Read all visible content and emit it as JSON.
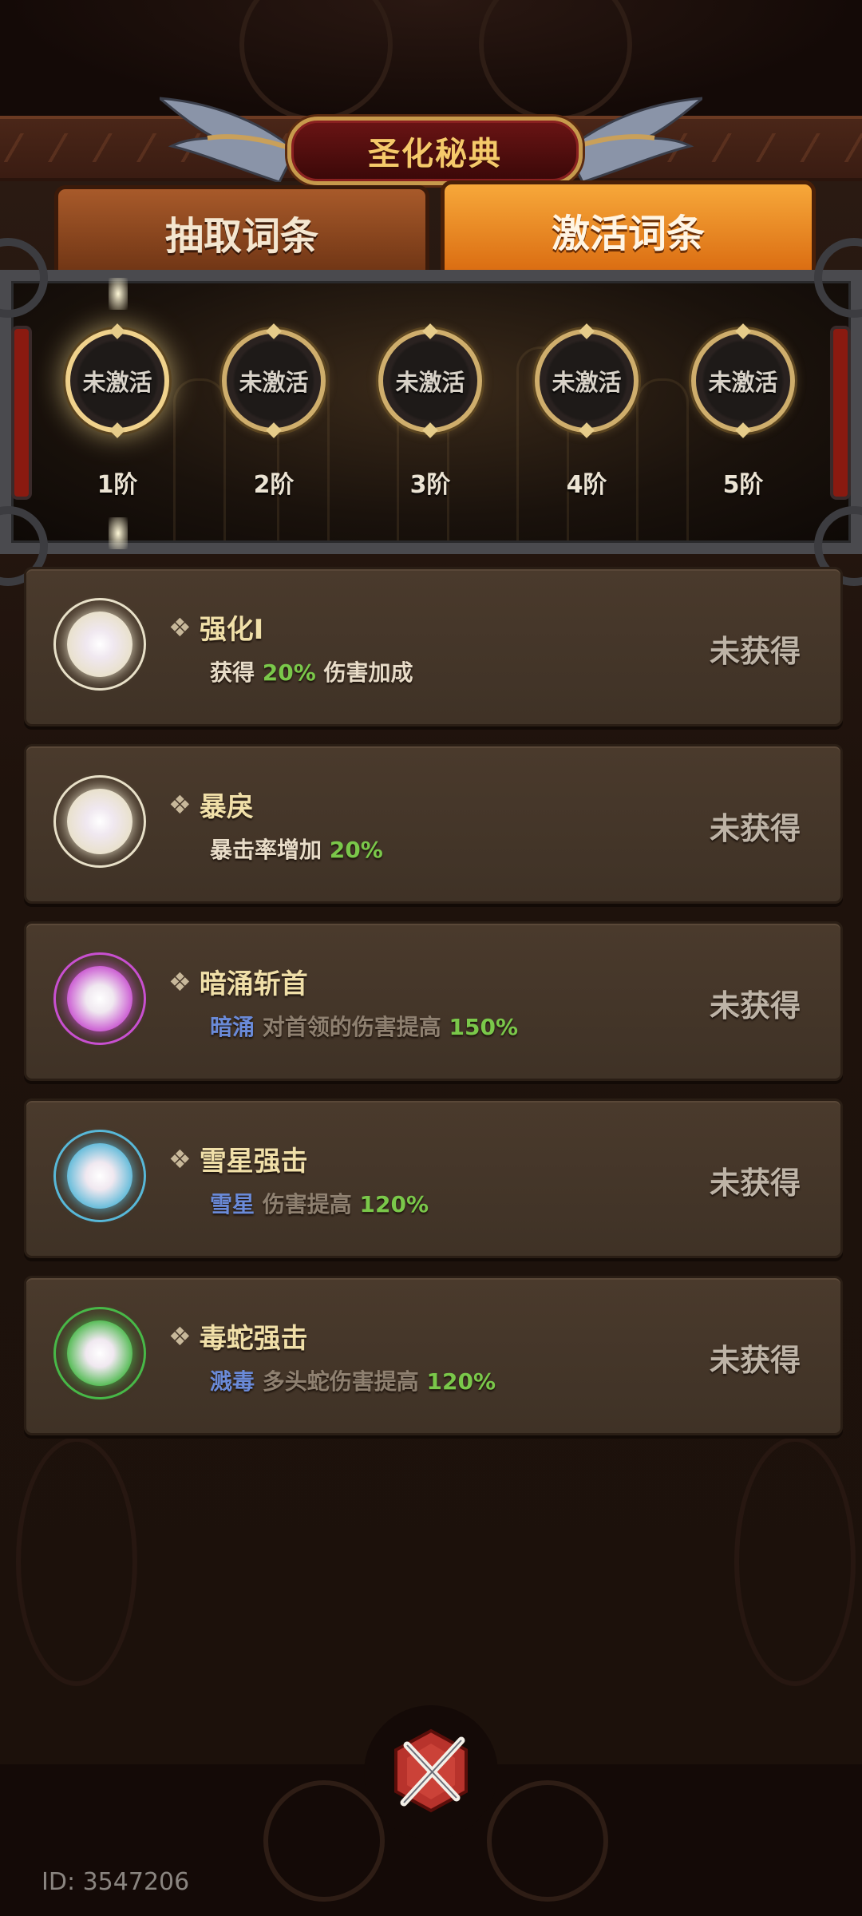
{
  "header": {
    "title": "圣化秘典"
  },
  "tabs": [
    {
      "label": "抽取词条",
      "selected": false
    },
    {
      "label": "激活词条",
      "selected": true
    }
  ],
  "tiers": [
    {
      "state": "未激活",
      "level": "1阶",
      "highlighted": true
    },
    {
      "state": "未激活",
      "level": "2阶",
      "highlighted": false
    },
    {
      "state": "未激活",
      "level": "3阶",
      "highlighted": false
    },
    {
      "state": "未激活",
      "level": "4阶",
      "highlighted": false
    },
    {
      "state": "未激活",
      "level": "5阶",
      "highlighted": false
    }
  ],
  "affixes": [
    {
      "name": "强化I",
      "desc_pre": "获得",
      "keyword": "",
      "desc_mid": "",
      "value": "20%",
      "desc_post": "伤害加成",
      "status": "未获得",
      "orb_color": "#e8e0c8"
    },
    {
      "name": "暴戾",
      "desc_pre": "暴击率增加",
      "keyword": "",
      "desc_mid": "",
      "value": "20%",
      "desc_post": "",
      "status": "未获得",
      "orb_color": "#e8e0c8"
    },
    {
      "name": "暗涌斩首",
      "desc_pre": "",
      "keyword": "暗涌",
      "desc_mid": "对首领的伤害提高",
      "value": "150%",
      "desc_post": "",
      "status": "未获得",
      "orb_color": "#c850d0"
    },
    {
      "name": "雪星强击",
      "desc_pre": "",
      "keyword": "雪星",
      "desc_mid": "伤害提高",
      "value": "120%",
      "desc_post": "",
      "status": "未获得",
      "orb_color": "#58b8d8"
    },
    {
      "name": "毒蛇强击",
      "desc_pre": "",
      "keyword": "溅毒",
      "desc_mid": "多头蛇伤害提高",
      "value": "120%",
      "desc_post": "",
      "status": "未获得",
      "orb_color": "#48b848"
    }
  ],
  "footer": {
    "id_label": "ID: 3547206"
  }
}
